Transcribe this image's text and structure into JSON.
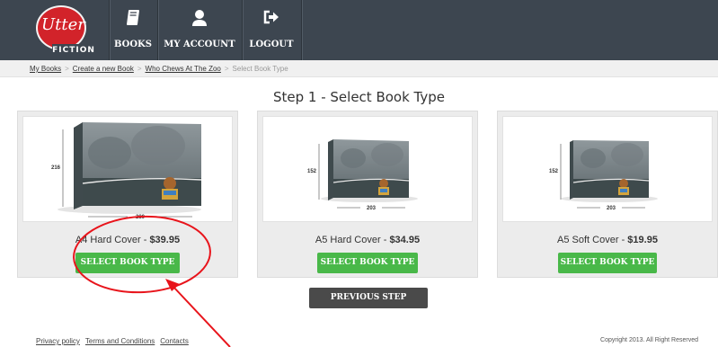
{
  "header": {
    "logo": {
      "text": "Utter",
      "sub": "FICTION"
    },
    "nav": [
      {
        "label": "BOOKS",
        "icon": "book-icon"
      },
      {
        "label": "MY ACCOUNT",
        "icon": "user-icon"
      },
      {
        "label": "LOGOUT",
        "icon": "logout-icon"
      }
    ]
  },
  "breadcrumb": {
    "items": [
      "My Books",
      "Create a new Book",
      "Who Chews At The Zoo"
    ],
    "current": "Select Book Type",
    "separator": ">"
  },
  "page_title": "Step 1 - Select Book Type",
  "cards": [
    {
      "name": "A4 Hard Cover",
      "dash": " - ",
      "price": "$39.95",
      "height_dim": "216",
      "width_dim": "280",
      "button": "SELECT BOOK TYPE"
    },
    {
      "name": "A5 Hard Cover",
      "dash": " - ",
      "price": "$34.95",
      "height_dim": "152",
      "width_dim": "203",
      "button": "SELECT BOOK TYPE"
    },
    {
      "name": "A5 Soft Cover",
      "dash": " - ",
      "price": "$19.95",
      "height_dim": "152",
      "width_dim": "203",
      "button": "SELECT BOOK TYPE"
    }
  ],
  "previous_button": "PREVIOUS STEP",
  "footer": {
    "links": [
      "Privacy policy",
      "Terms and Conditions",
      "Contacts"
    ],
    "copyright": "Copyright 2013. All Right Reserved"
  },
  "colors": {
    "header_bg": "#3d4650",
    "logo_red": "#d2232a",
    "button_green": "#49b849",
    "button_dark": "#4a4a4a",
    "annotation_red": "#e8141b"
  }
}
